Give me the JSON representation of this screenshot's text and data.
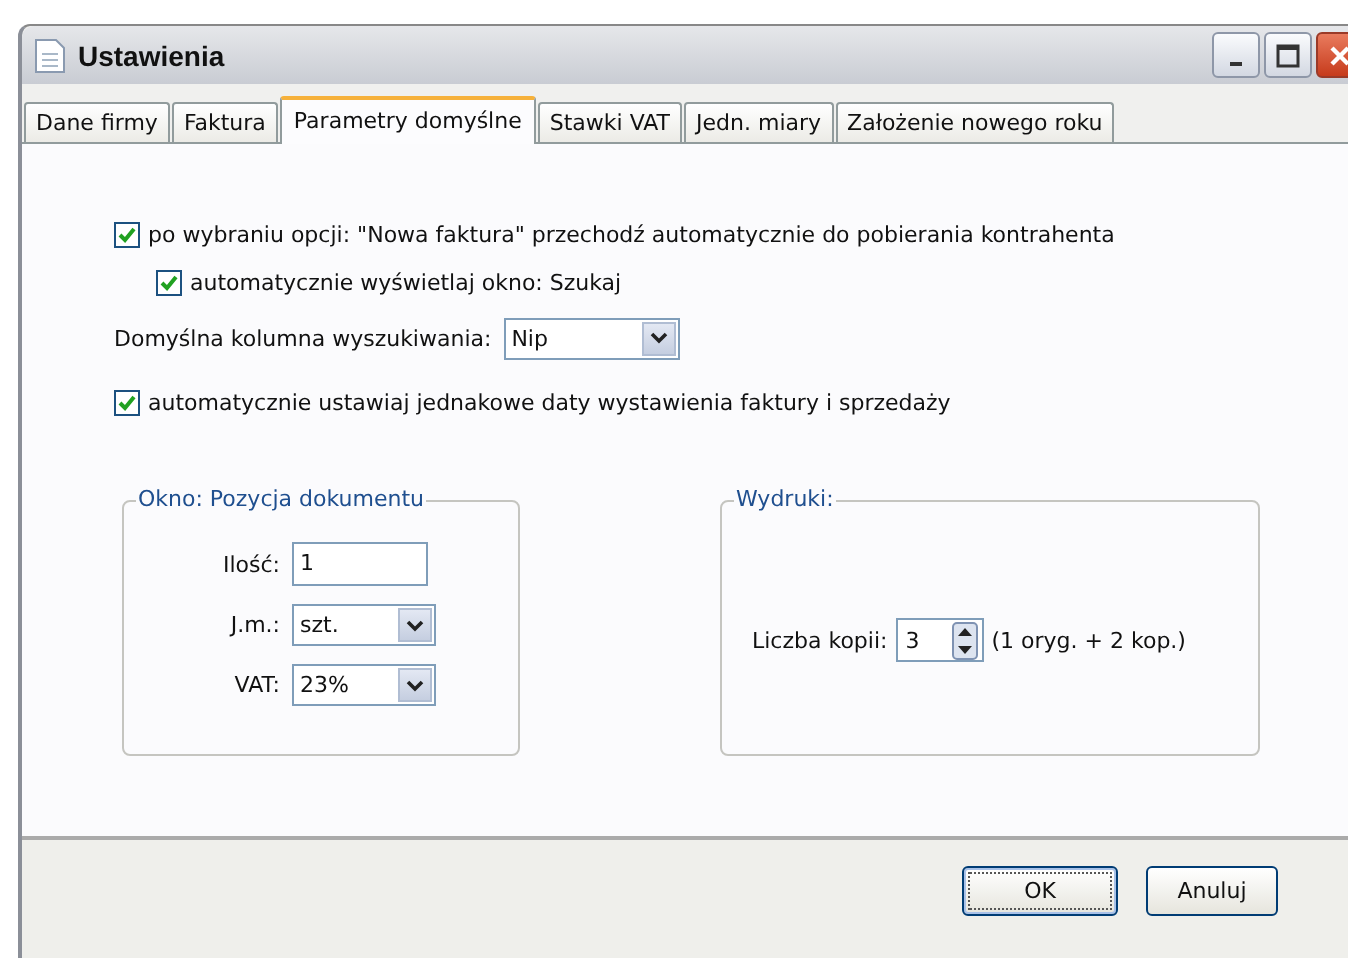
{
  "window": {
    "title": "Ustawienia"
  },
  "tabs": [
    {
      "label": "Dane firmy",
      "selected": false
    },
    {
      "label": "Faktura",
      "selected": false
    },
    {
      "label": "Parametry domyślne",
      "selected": true
    },
    {
      "label": "Stawki VAT",
      "selected": false
    },
    {
      "label": "Jedn. miary",
      "selected": false
    },
    {
      "label": "Założenie nowego roku",
      "selected": false
    }
  ],
  "options": [
    {
      "kind": "checkbox",
      "label": "po wybraniu opcji: \"Nowa faktura\" przechodź automatycznie do pobierania kontrahenta",
      "checked": true,
      "indented": false
    },
    {
      "kind": "checkbox",
      "label": "automatycznie wyświetlaj okno: Szukaj",
      "checked": true,
      "indented": true
    },
    {
      "kind": "dropdown",
      "label": "Domyślna kolumna wyszukiwania:",
      "value": "Nip"
    },
    {
      "kind": "checkbox",
      "label": "automatycznie ustawiaj jednakowe daty wystawienia faktury i sprzedaży",
      "checked": true,
      "indented": false
    }
  ],
  "document_group": {
    "title": "Okno: Pozycja dokumentu",
    "fields": [
      {
        "kind": "text",
        "label": "Ilość:",
        "value": "1"
      },
      {
        "kind": "dropdown",
        "label": "J.m.:",
        "value": "szt."
      },
      {
        "kind": "dropdown",
        "label": "VAT:",
        "value": "23%"
      }
    ]
  },
  "print_group": {
    "title": "Wydruki:",
    "label": "Liczba kopii:",
    "value": "3",
    "note": "(1 oryg. + 2 kop.)"
  },
  "buttons": [
    "OK",
    "Anuluj"
  ]
}
